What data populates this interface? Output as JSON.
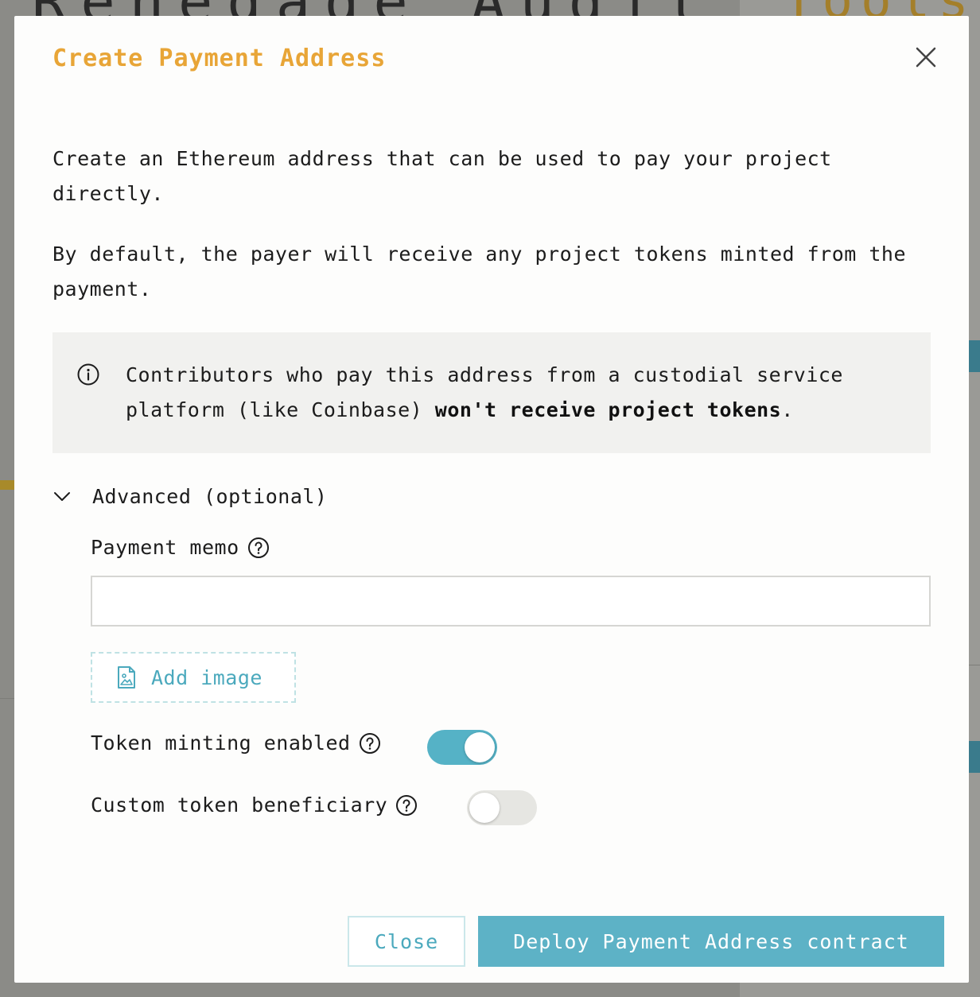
{
  "background": {
    "title": "Renegade Audit Fund",
    "right_title": "Tools"
  },
  "modal": {
    "title": "Create Payment Address",
    "description_1": "Create an Ethereum address that can be used to pay your project directly.",
    "description_2": "By default, the payer will receive any project tokens minted from the payment.",
    "info": {
      "text_before": "Contributors who pay this address from a custodial service platform (like Coinbase) ",
      "text_bold": "won't receive project tokens",
      "text_after": "."
    },
    "advanced": {
      "label": "Advanced (optional)",
      "expanded": true,
      "memo_label": "Payment memo",
      "memo_value": "",
      "add_image_label": "Add image",
      "token_minting_label": "Token minting enabled",
      "token_minting_enabled": true,
      "custom_beneficiary_label": "Custom token beneficiary",
      "custom_beneficiary_enabled": false
    },
    "buttons": {
      "close": "Close",
      "deploy": "Deploy Payment Address contract"
    },
    "colors": {
      "title": "#e8a537",
      "accent": "#55b2c6",
      "link": "#4ba9bd"
    },
    "icons": {
      "close": "close-icon",
      "info": "info-icon",
      "chevron": "chevron-down-icon",
      "help": "help-circle-icon",
      "image": "image-file-icon"
    }
  }
}
